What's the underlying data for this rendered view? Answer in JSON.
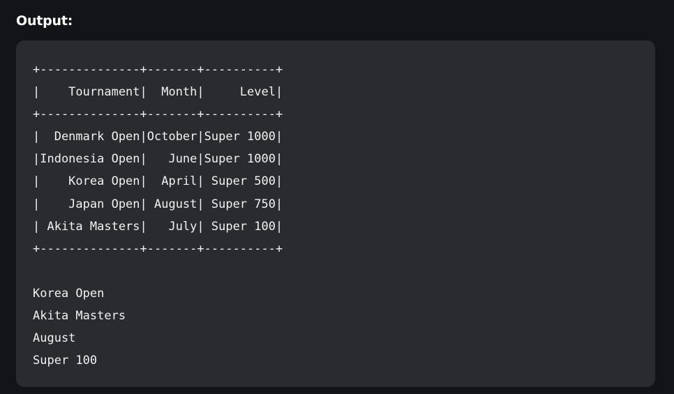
{
  "header": {
    "label": "Output:"
  },
  "output": {
    "lines": [
      "+--------------+-------+----------+",
      "|    Tournament|  Month|     Level|",
      "+--------------+-------+----------+",
      "|  Denmark Open|October|Super 1000|",
      "|Indonesia Open|   June|Super 1000|",
      "|    Korea Open|  April| Super 500|",
      "|    Japan Open| August| Super 750|",
      "| Akita Masters|   July| Super 100|",
      "+--------------+-------+----------+",
      "",
      "Korea Open",
      "Akita Masters",
      "August",
      "Super 100"
    ]
  }
}
